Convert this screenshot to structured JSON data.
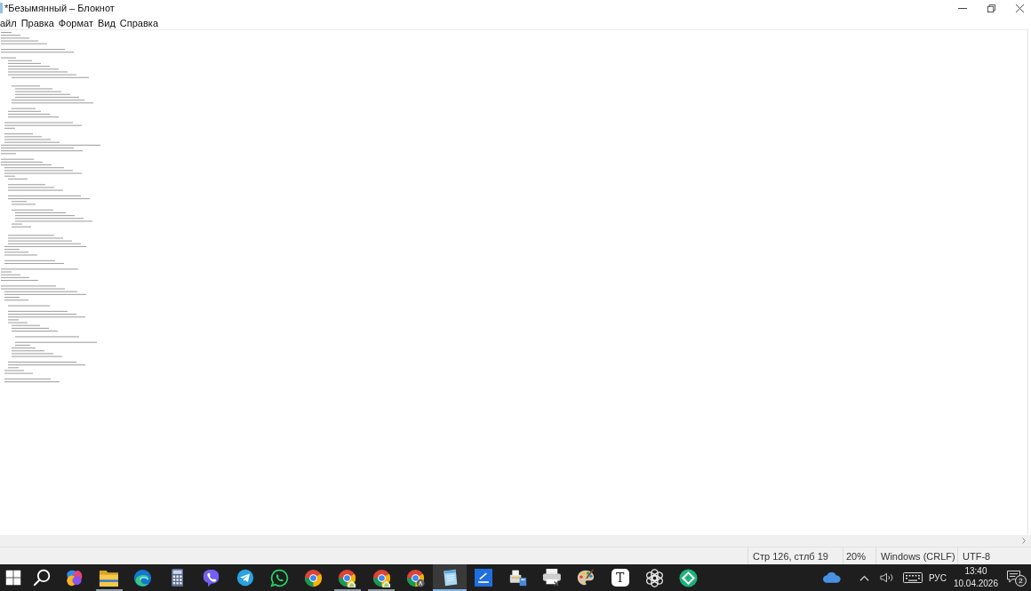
{
  "window": {
    "title": "*Безымянный – Блокнот"
  },
  "menu": [
    {
      "label": "айл"
    },
    {
      "label": "Правка"
    },
    {
      "label": "Формат"
    },
    {
      "label": "Вид"
    },
    {
      "label": "Справка"
    }
  ],
  "status_bar": {
    "position": "Стр 126, стлб 19",
    "zoom": "20%",
    "line_endings": "Windows (CRLF)",
    "encoding": "UTF-8"
  },
  "taskbar": {
    "apps": [
      {
        "kind": "winlogo",
        "running": false,
        "selected": false
      },
      {
        "kind": "search",
        "running": false,
        "selected": false
      },
      {
        "kind": "petals",
        "running": false,
        "selected": false
      },
      {
        "kind": "folder",
        "running": true,
        "selected": false
      },
      {
        "kind": "swirl",
        "running": false,
        "selected": false
      },
      {
        "kind": "calculator",
        "running": false,
        "selected": false
      },
      {
        "kind": "phonebubble",
        "running": false,
        "selected": false
      },
      {
        "kind": "plane",
        "running": false,
        "selected": false
      },
      {
        "kind": "phonering",
        "running": false,
        "selected": false
      },
      {
        "kind": "ring",
        "running": false,
        "selected": false
      },
      {
        "kind": "ringhouse",
        "running": true,
        "selected": false
      },
      {
        "kind": "ringhouse",
        "running": true,
        "selected": false
      },
      {
        "kind": "ringbadge",
        "running": false,
        "selected": false
      },
      {
        "kind": "notepad",
        "running": true,
        "selected": true
      },
      {
        "kind": "bluetile",
        "running": false,
        "selected": false
      },
      {
        "kind": "fax",
        "running": false,
        "selected": false
      },
      {
        "kind": "printer",
        "running": false,
        "selected": false
      },
      {
        "kind": "palette",
        "running": false,
        "selected": false
      },
      {
        "kind": "letter",
        "glyph": "T",
        "running": false,
        "selected": false
      },
      {
        "kind": "knot",
        "running": false,
        "selected": false
      },
      {
        "kind": "diamond",
        "running": false,
        "selected": false
      }
    ],
    "tray": {
      "language": "РУС",
      "time": "13:40",
      "date": "10.04.2026",
      "notifications": "2"
    }
  }
}
